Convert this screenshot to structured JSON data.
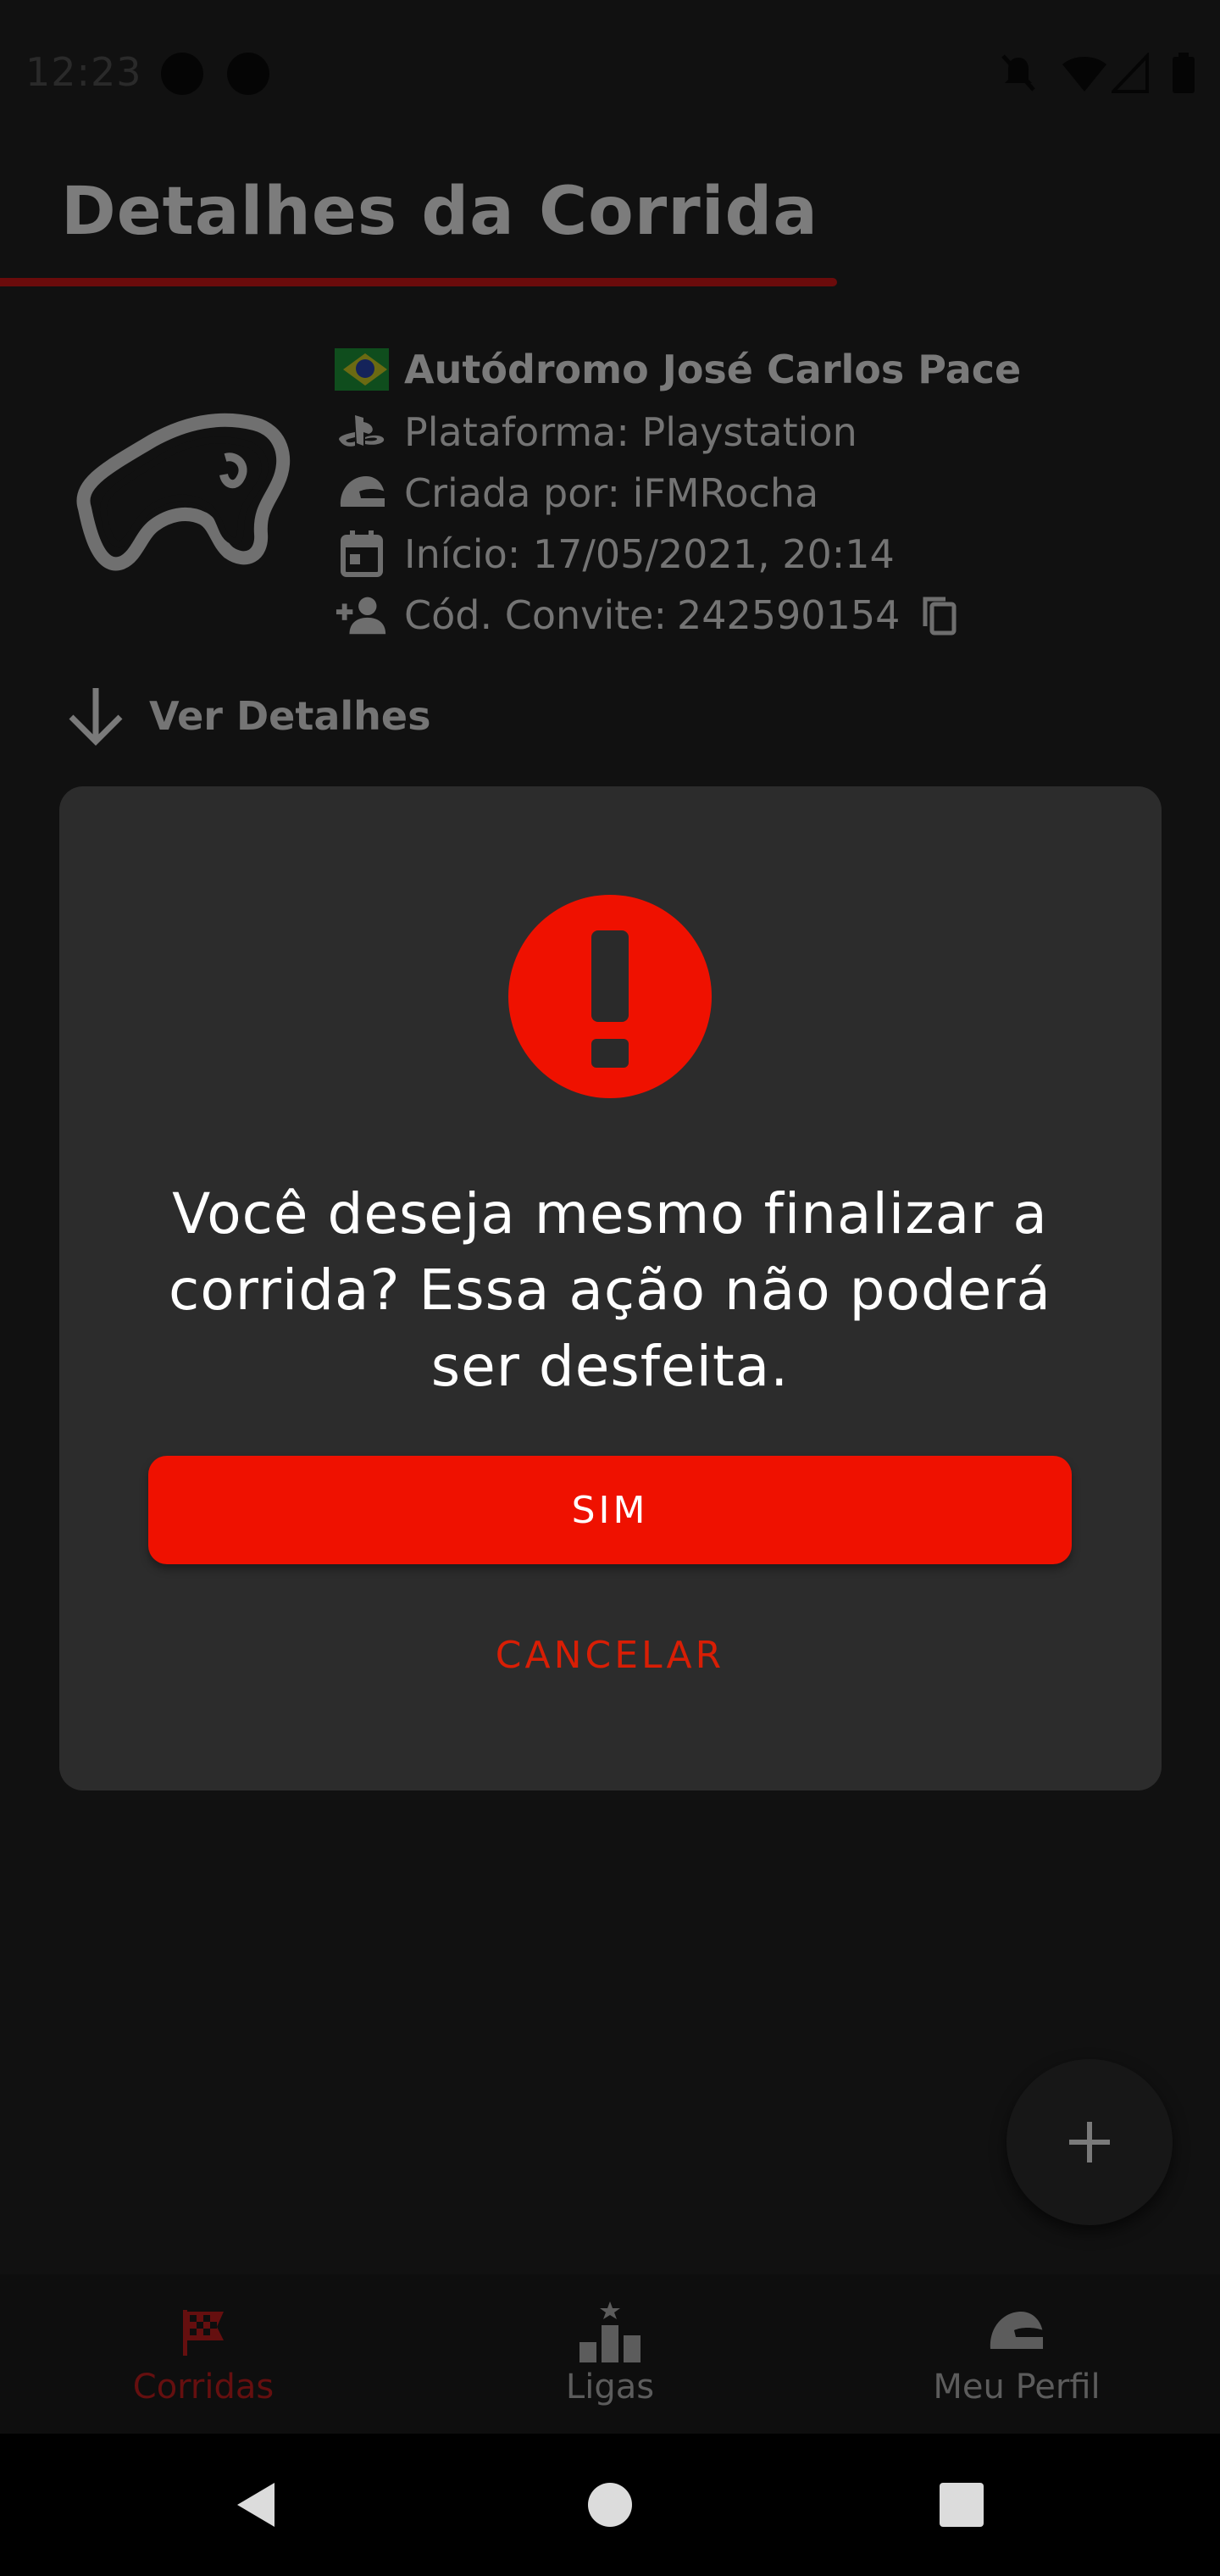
{
  "status_bar": {
    "time": "12:23"
  },
  "header": {
    "title": "Detalhes da Corrida"
  },
  "race": {
    "circuit": "Autódromo José Carlos Pace",
    "platform": "Plataforma: Playstation",
    "created_by": "Criada por: iFMRocha",
    "start": "Início: 17/05/2021, 20:14",
    "invite_label": "Cód. Convite:",
    "invite_code": "242590154"
  },
  "details_toggle": {
    "label": "Ver Detalhes"
  },
  "dialog": {
    "message": "Você deseja mesmo finalizar a corrida? Essa ação não poderá ser desfeita.",
    "confirm_label": "SIM",
    "cancel_label": "CANCELAR"
  },
  "fab": {
    "icon": "plus-icon"
  },
  "bottom_nav": {
    "items": [
      {
        "label": "Corridas",
        "icon": "checkered-flag-icon",
        "active": true
      },
      {
        "label": "Ligas",
        "icon": "podium-icon",
        "active": false
      },
      {
        "label": "Meu Perfil",
        "icon": "helmet-icon",
        "active": false
      }
    ]
  },
  "colors": {
    "accent": "#ef1100",
    "background": "#111111",
    "dialog": "#2c2c2c"
  }
}
